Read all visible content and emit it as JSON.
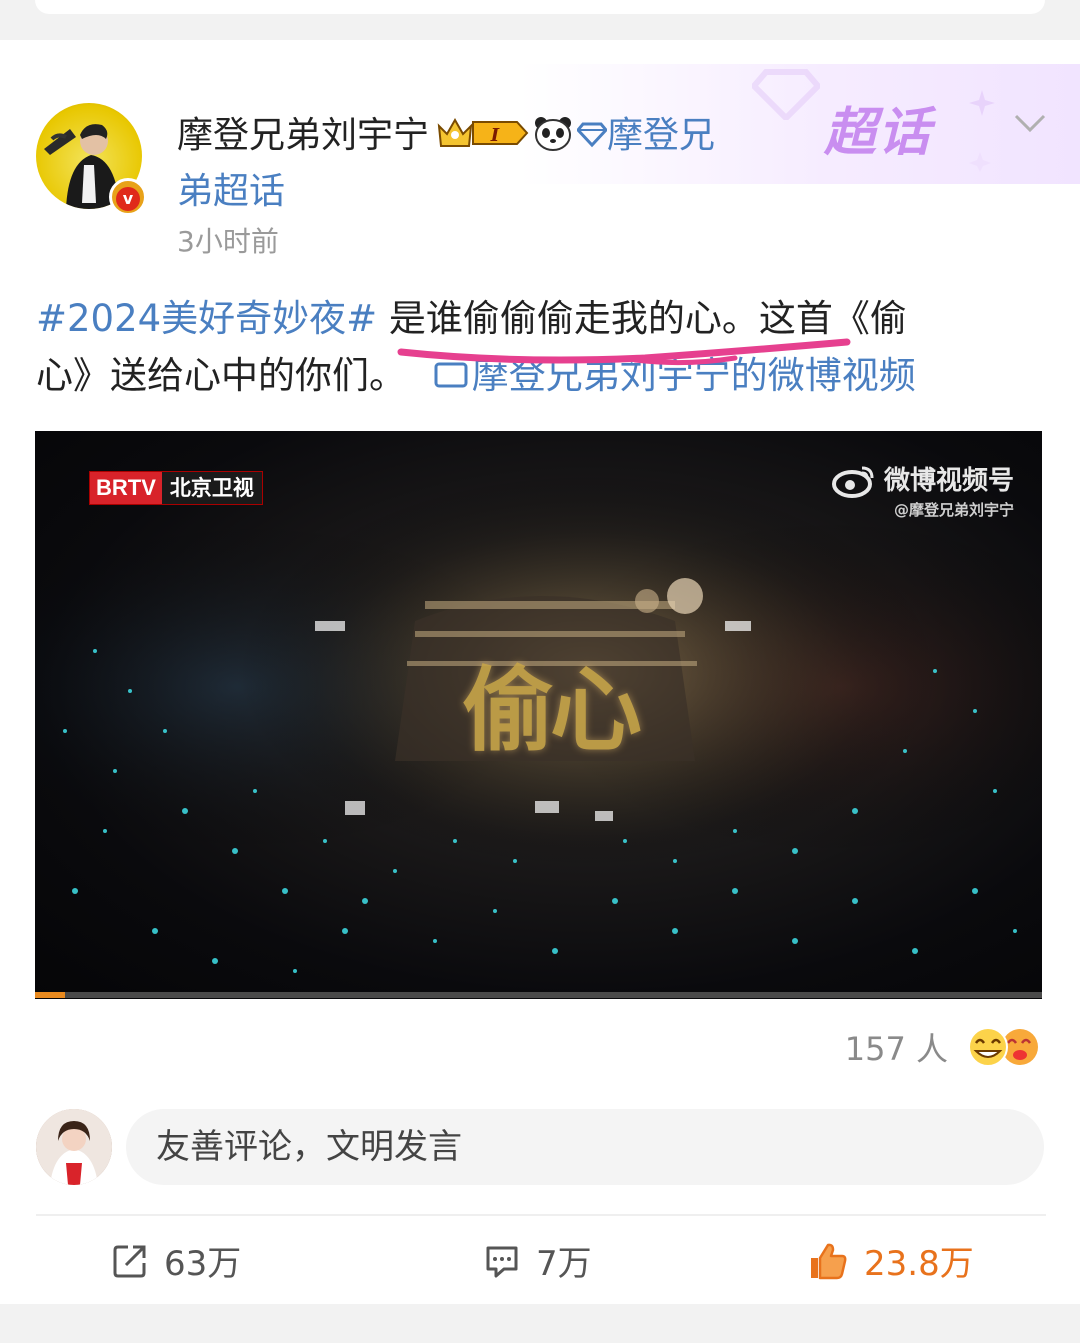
{
  "post": {
    "author_name": "摩登兄弟刘宇宁",
    "vip_level": "I",
    "topic_part1": "摩登兄",
    "topic_part2": "弟超话",
    "time": "3小时前",
    "chaohua_label": "超话",
    "content": {
      "hashtag": "#2024美好奇妙夜#",
      "text_line1": " 是谁偷偷偷走我的心。这首《偷",
      "text_line2": "心》送给心中的你们。",
      "video_link": "摩登兄弟刘宇宁的微博视频"
    }
  },
  "video": {
    "channel_logo_en": "BRTV",
    "channel_logo_cn": "北京卫视",
    "watermark_title": "微博视频号",
    "watermark_handle": "@摩登兄弟刘宇宁",
    "song_title": "偷心",
    "progress": 0.03
  },
  "reactions": {
    "count_label": "157 人"
  },
  "comment_box": {
    "placeholder": "友善评论，文明发言"
  },
  "actions": {
    "repost_count": "63万",
    "comment_count": "7万",
    "like_count": "23.8万"
  },
  "colors": {
    "link_blue": "#4a7fc1",
    "like_orange": "#e8721c",
    "chaohua_purple": "#c98ef0",
    "highlight_pink": "#e6408f"
  }
}
